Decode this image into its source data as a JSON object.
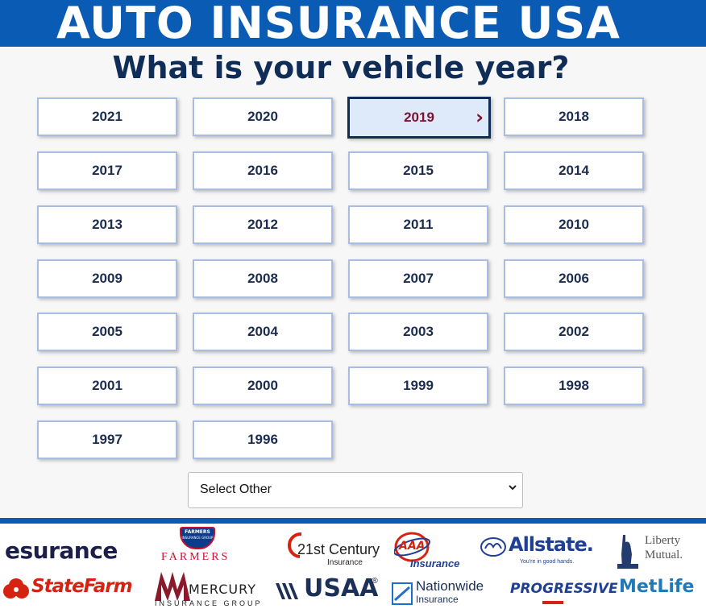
{
  "header": {
    "title": "AUTO INSURANCE USA",
    "bg_color": "#0a5bb3"
  },
  "question": "What is your vehicle year?",
  "years": [
    "2021",
    "2020",
    "2019",
    "2018",
    "2017",
    "2016",
    "2015",
    "2014",
    "2013",
    "2012",
    "2011",
    "2010",
    "2009",
    "2008",
    "2007",
    "2006",
    "2005",
    "2004",
    "2003",
    "2002",
    "2001",
    "2000",
    "1999",
    "1998",
    "1997",
    "1996"
  ],
  "selected_year": "2019",
  "selected_icon": "chevron-right-icon",
  "select_other": {
    "label": "Select Other"
  },
  "logos": {
    "esurance": "esurance",
    "farmers_badge_top": "FARMERS",
    "farmers_badge_sub": "INSURANCE GROUP",
    "farmers": "FARMERS",
    "century_main": "21st Century",
    "century_sub": "Insurance",
    "aaa_badge": "AAA",
    "aaa_word": "Insurance",
    "allstate": "Allstate.",
    "allstate_tagline": "You're in good hands.",
    "liberty_line1": "Liberty",
    "liberty_line2": "Mutual.",
    "statefarm": "StateFarm",
    "mercury_name": "MERCURY",
    "mercury_group": "INSURANCE GROUP",
    "usaa": "USAA",
    "usaa_mark": "®",
    "nationwide_name": "Nationwide",
    "nationwide_sub": "Insurance",
    "progressive": "PROGRESSIVE",
    "metlife": "MetLife"
  },
  "colors": {
    "accent": "#0a5bb3",
    "navy": "#0f2d57",
    "selected_text": "#7a1230",
    "statefarm_red": "#d62311",
    "allstate_blue": "#1f3f94",
    "esurance_navy": "#1b1f4a"
  }
}
